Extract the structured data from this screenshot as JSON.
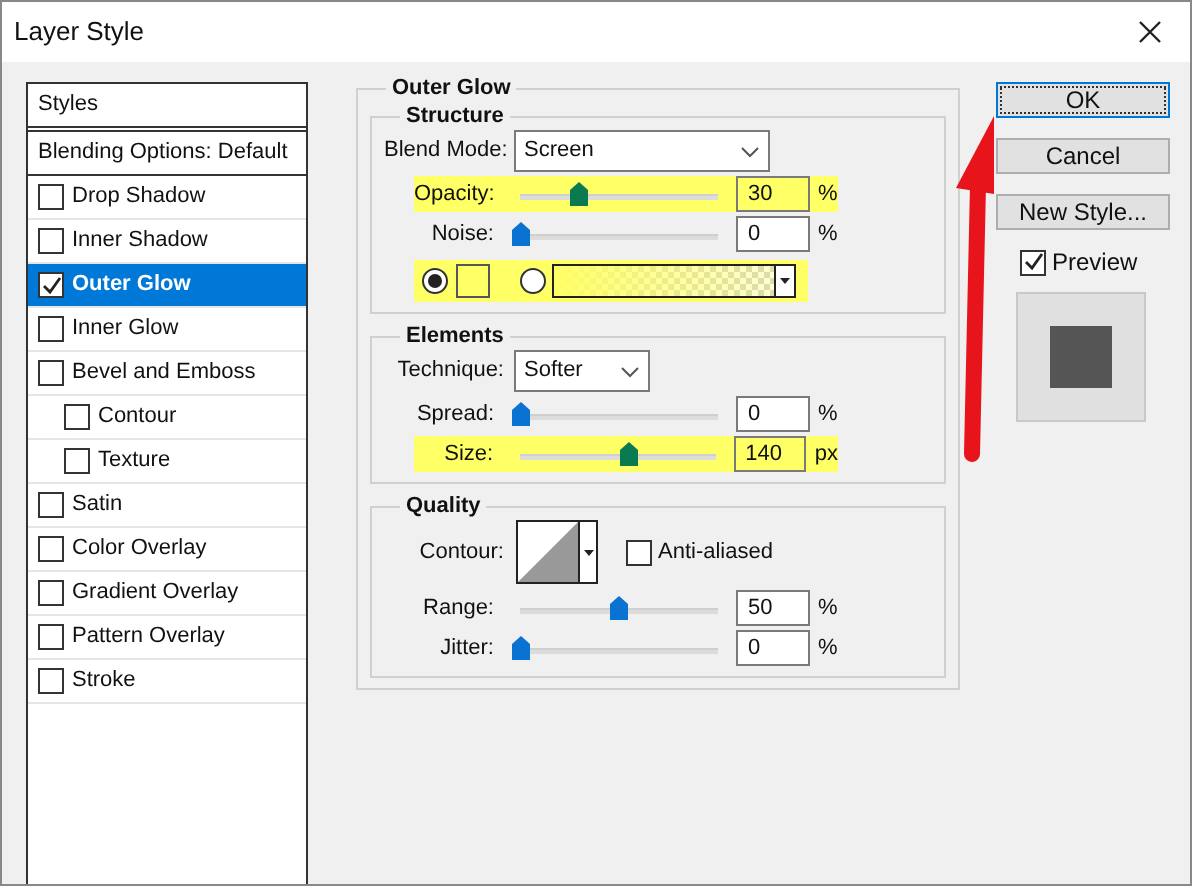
{
  "window": {
    "title": "Layer Style"
  },
  "styles_panel": {
    "header": "Styles",
    "blending_options": "Blending Options: Default",
    "items": [
      {
        "label": "Drop Shadow",
        "checked": false,
        "selected": false
      },
      {
        "label": "Inner Shadow",
        "checked": false,
        "selected": false
      },
      {
        "label": "Outer Glow",
        "checked": true,
        "selected": true
      },
      {
        "label": "Inner Glow",
        "checked": false,
        "selected": false
      },
      {
        "label": "Bevel and Emboss",
        "checked": false,
        "selected": false,
        "children": [
          {
            "label": "Contour",
            "checked": false,
            "selected": false
          },
          {
            "label": "Texture",
            "checked": false,
            "selected": false
          }
        ]
      },
      {
        "label": "Satin",
        "checked": false,
        "selected": false
      },
      {
        "label": "Color Overlay",
        "checked": false,
        "selected": false
      },
      {
        "label": "Gradient Overlay",
        "checked": false,
        "selected": false
      },
      {
        "label": "Pattern Overlay",
        "checked": false,
        "selected": false
      },
      {
        "label": "Stroke",
        "checked": false,
        "selected": false
      }
    ]
  },
  "outer_glow": {
    "title": "Outer Glow",
    "structure": {
      "title": "Structure",
      "blend_mode": {
        "label": "Blend Mode:",
        "value": "Screen"
      },
      "sliders": [
        {
          "label": "Opacity:",
          "level": 0.3,
          "value": "30",
          "unit": "%",
          "highlighted": true
        },
        {
          "label": "Noise:",
          "level": 0,
          "value": "0",
          "unit": "%",
          "highlighted": false
        }
      ],
      "color_row": {
        "highlighted": true,
        "color_selected": true,
        "gradient_selected": false,
        "color": "#ffff66"
      }
    },
    "elements": {
      "title": "Elements",
      "technique": {
        "label": "Technique:",
        "value": "Softer"
      },
      "sliders": [
        {
          "label": "Spread:",
          "level": 0,
          "value": "0",
          "unit": "%",
          "highlighted": false
        },
        {
          "label": "Size:",
          "level": 0.56,
          "value": "140",
          "unit": "px",
          "highlighted": true
        }
      ]
    },
    "quality": {
      "title": "Quality",
      "contour_label": "Contour:",
      "anti_aliased": {
        "label": "Anti-aliased",
        "checked": false
      },
      "sliders": [
        {
          "label": "Range:",
          "level": 0.5,
          "value": "50",
          "unit": "%",
          "highlighted": false
        },
        {
          "label": "Jitter:",
          "level": 0,
          "value": "0",
          "unit": "%",
          "highlighted": false
        }
      ]
    }
  },
  "buttons": [
    {
      "label": "OK",
      "default": true
    },
    {
      "label": "Cancel",
      "default": false
    },
    {
      "label": "New Style...",
      "default": false
    }
  ],
  "preview": {
    "label": "Preview",
    "checked": true
  }
}
